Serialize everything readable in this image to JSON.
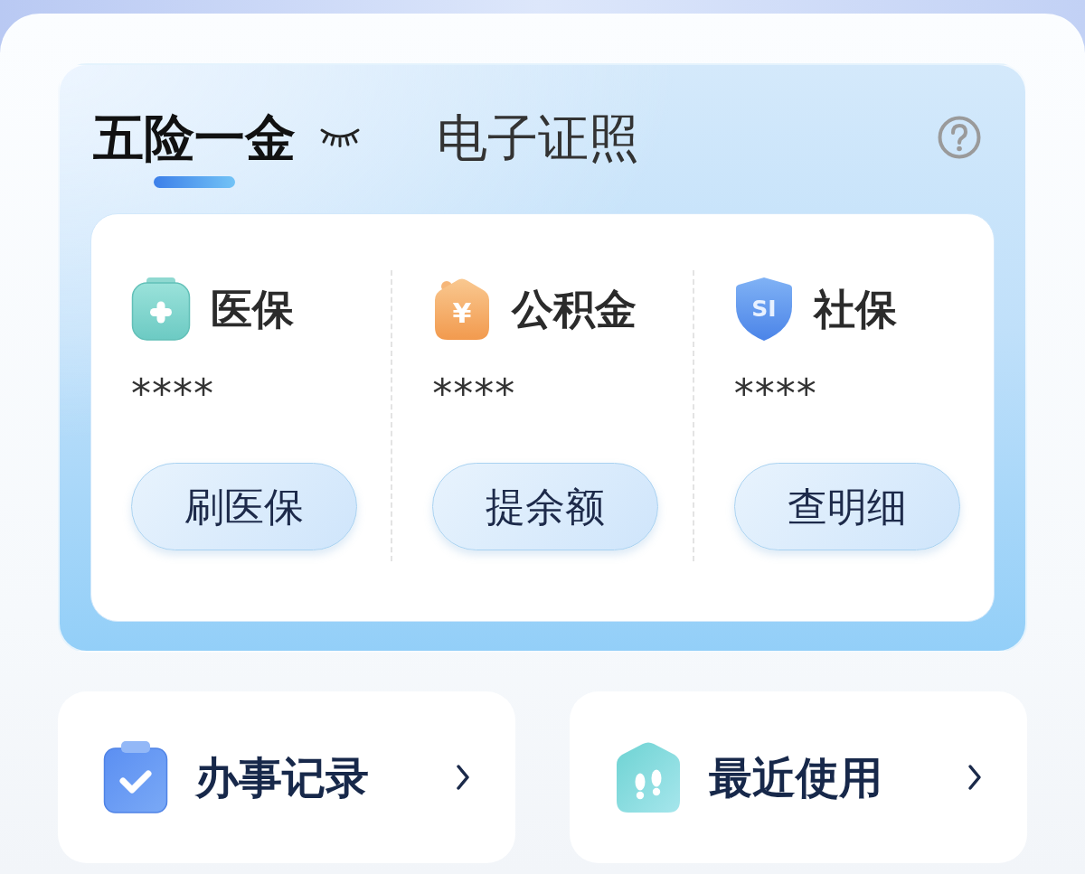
{
  "tabs": [
    {
      "label": "五险一金",
      "selected": true
    },
    {
      "label": "电子证照",
      "selected": false
    }
  ],
  "amounts_hidden": true,
  "accounts": [
    {
      "kind": "medical",
      "title": "医保",
      "value": "****",
      "action": "刷医保"
    },
    {
      "kind": "fund",
      "title": "公积金",
      "icon_text": "¥",
      "value": "****",
      "action": "提余额"
    },
    {
      "kind": "social",
      "title": "社保",
      "icon_text": "SI",
      "value": "****",
      "action": "查明细"
    }
  ],
  "shortcuts": [
    {
      "kind": "records",
      "label": "办事记录"
    },
    {
      "kind": "recent",
      "label": "最近使用"
    }
  ]
}
